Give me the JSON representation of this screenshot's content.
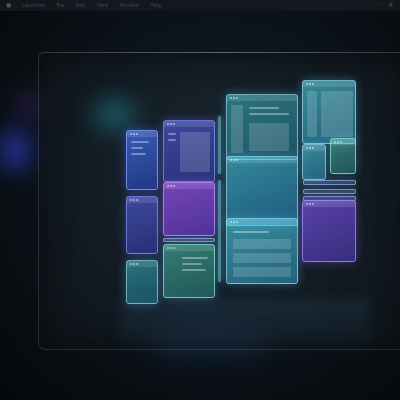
{
  "menubar": {
    "apple_icon": "apple-icon",
    "items": [
      "Launcher",
      "File",
      "Edit",
      "View",
      "Window",
      "Help"
    ]
  },
  "colors": {
    "background": "#0b1218",
    "accent_cyan": "#5fd0e6",
    "accent_blue": "#4a6ee6",
    "accent_purple": "#9650e6"
  }
}
